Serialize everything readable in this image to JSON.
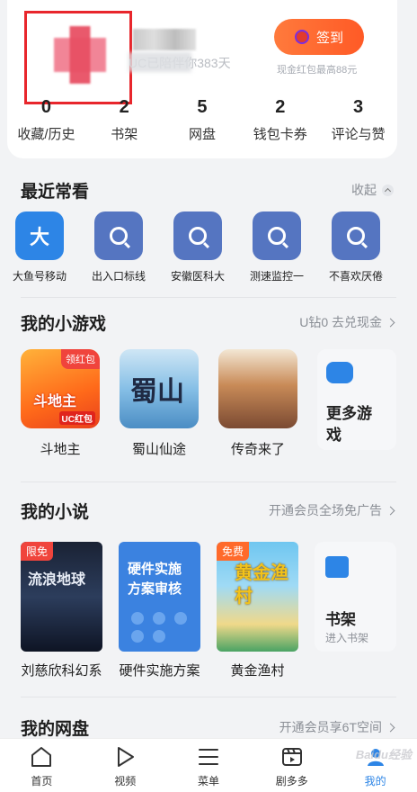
{
  "profile": {
    "days_text": "UC已陪伴你383天",
    "signin_label": "签到",
    "signin_sub": "现金红包最高88元"
  },
  "stats": [
    {
      "num": "0",
      "label": "收藏/历史"
    },
    {
      "num": "2",
      "label": "书架"
    },
    {
      "num": "5",
      "label": "网盘"
    },
    {
      "num": "2",
      "label": "钱包卡券"
    },
    {
      "num": "3",
      "label": "评论与赞"
    }
  ],
  "recent": {
    "title": "最近常看",
    "collapse_label": "收起",
    "items": [
      {
        "icon_text": "大",
        "label": "大鱼号移动"
      },
      {
        "label": "出入口标线"
      },
      {
        "label": "安徽医科大"
      },
      {
        "label": "测速监控一"
      },
      {
        "label": "不喜欢厌倦"
      }
    ]
  },
  "games": {
    "title": "我的小游戏",
    "right_label": "U钻0 去兑现金",
    "items": [
      {
        "label": "斗地主",
        "badge": "领红包",
        "art_text": "斗地主",
        "art_sub": "UC红包"
      },
      {
        "label": "蜀山仙途",
        "art_text": "蜀山"
      },
      {
        "label": "传奇来了"
      }
    ],
    "more_label": "更多游戏"
  },
  "novels": {
    "title": "我的小说",
    "right_label": "开通会员全场免广告",
    "items": [
      {
        "label": "刘慈欣科幻系",
        "tag": "限免",
        "cover_text": "流浪地球"
      },
      {
        "label": "硬件实施方案",
        "cover_text": "硬件实施方案审核"
      },
      {
        "label": "黄金渔村",
        "tag": "免费",
        "cover_text": "黄金渔村"
      }
    ],
    "shelf_title": "书架",
    "shelf_sub": "进入书架"
  },
  "netdisk": {
    "title": "我的网盘",
    "right_label": "开通会员享6T空间"
  },
  "nav": [
    {
      "label": "首页"
    },
    {
      "label": "视频"
    },
    {
      "label": "菜单"
    },
    {
      "label": "剧多多"
    },
    {
      "label": "我的"
    }
  ],
  "colors": {
    "accent": "#2d85e6",
    "signin": "#ff5a26",
    "badge": "#f0443c",
    "highlight_box": "#e8262c"
  },
  "watermark": "Baidu经验"
}
